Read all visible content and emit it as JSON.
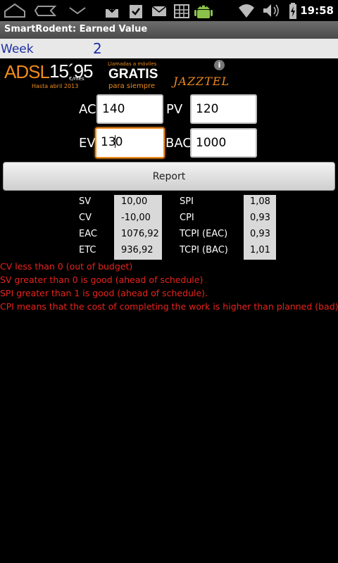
{
  "status_bar": {
    "time": "19:58",
    "icons": [
      "home-icon",
      "back-icon",
      "chevron-down-icon",
      "download-icon",
      "clipboard-check-icon",
      "mail-icon",
      "grid-icon",
      "android-icon",
      "wifi-icon",
      "volume-icon",
      "battery-charging-icon"
    ]
  },
  "app": {
    "title": "SmartRodent: Earned Value"
  },
  "week": {
    "label": "Week",
    "value": "2"
  },
  "ad": {
    "adsl": "ADSL",
    "price": "15´95",
    "per_month": "€/mes",
    "until": "Hasta abril 2013",
    "calls": "Llamadas a móviles",
    "free": "GRATIS",
    "forever": "para siempre",
    "brand": "JAZZTEL",
    "info": "i"
  },
  "inputs": {
    "ac": {
      "label": "AC",
      "value": "140"
    },
    "pv": {
      "label": "PV",
      "value": "120"
    },
    "ev": {
      "label": "EV",
      "value_before_caret": "13",
      "value_after_caret": "0"
    },
    "bac": {
      "label": "BAC",
      "value": "1000"
    }
  },
  "report_label": "Report",
  "results": {
    "sv": {
      "label": "SV",
      "value": "10,00"
    },
    "cv": {
      "label": "CV",
      "value": "-10,00"
    },
    "eac": {
      "label": "EAC",
      "value": "1076,92"
    },
    "etc": {
      "label": "ETC",
      "value": "936,92"
    },
    "spi": {
      "label": "SPI",
      "value": "1,08"
    },
    "cpi": {
      "label": "CPI",
      "value": "0,93"
    },
    "tcpi_eac": {
      "label": "TCPI (EAC)",
      "value": "0,93"
    },
    "tcpi_bac": {
      "label": "TCPI (BAC)",
      "value": "1,01"
    }
  },
  "messages": [
    "CV less than 0 (out of budget)",
    "SV greater than 0 is good (ahead of schedule)",
    "SPI greater than 1 is good (ahead of schedule).",
    "CPI means that the cost of completing the work is higher than planned (bad)"
  ],
  "colors": {
    "accent": "#f08a1c",
    "week_text": "#1c2fa3",
    "message": "#e8231c"
  }
}
